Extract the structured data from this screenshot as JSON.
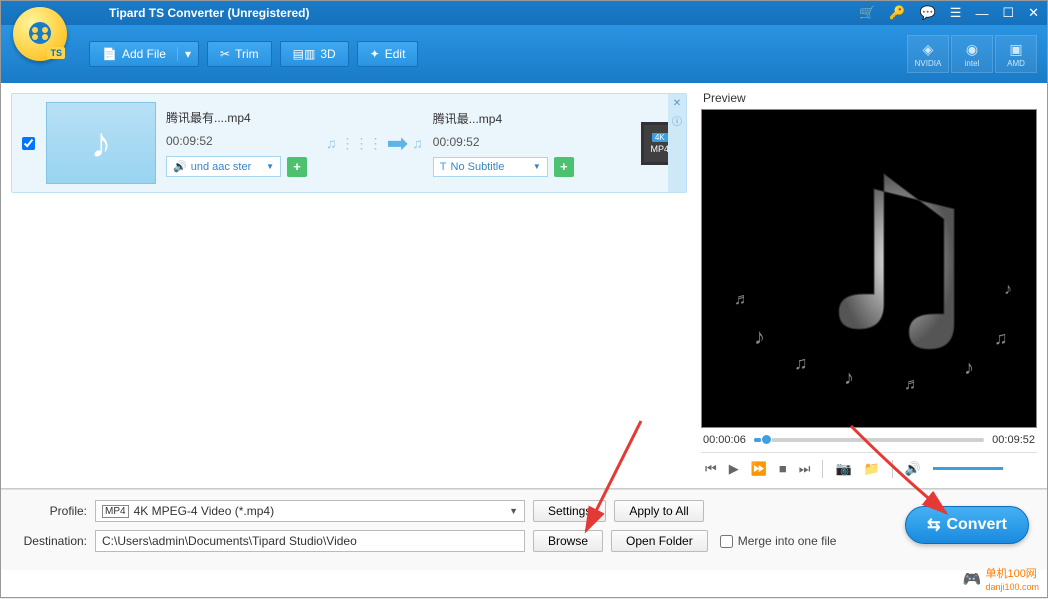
{
  "title": "Tipard TS Converter (Unregistered)",
  "logo_tag": "TS",
  "toolbar": {
    "add_file": "Add File",
    "trim": "Trim",
    "td3d": "3D",
    "edit": "Edit"
  },
  "gpu": {
    "nvidia": "NVIDIA",
    "intel": "intel",
    "amd": "AMD"
  },
  "file": {
    "src_name": "腾讯最有....mp4",
    "src_dur": "00:09:52",
    "dst_name": "腾讯最...mp4",
    "dst_dur": "00:09:52",
    "audio_track": "und aac ster",
    "subtitle": "No Subtitle",
    "badge_top": "4K",
    "badge_bot": "MP4"
  },
  "preview": {
    "label": "Preview",
    "current": "00:00:06",
    "total": "00:09:52"
  },
  "profile": {
    "label": "Profile:",
    "value": "4K MPEG-4 Video (*.mp4)",
    "settings": "Settings",
    "apply_all": "Apply to All"
  },
  "destination": {
    "label": "Destination:",
    "value": "C:\\Users\\admin\\Documents\\Tipard Studio\\Video",
    "browse": "Browse",
    "open_folder": "Open Folder",
    "merge": "Merge into one file"
  },
  "convert": "Convert",
  "watermark": "单机100网",
  "watermark_sub": "danji100.com"
}
